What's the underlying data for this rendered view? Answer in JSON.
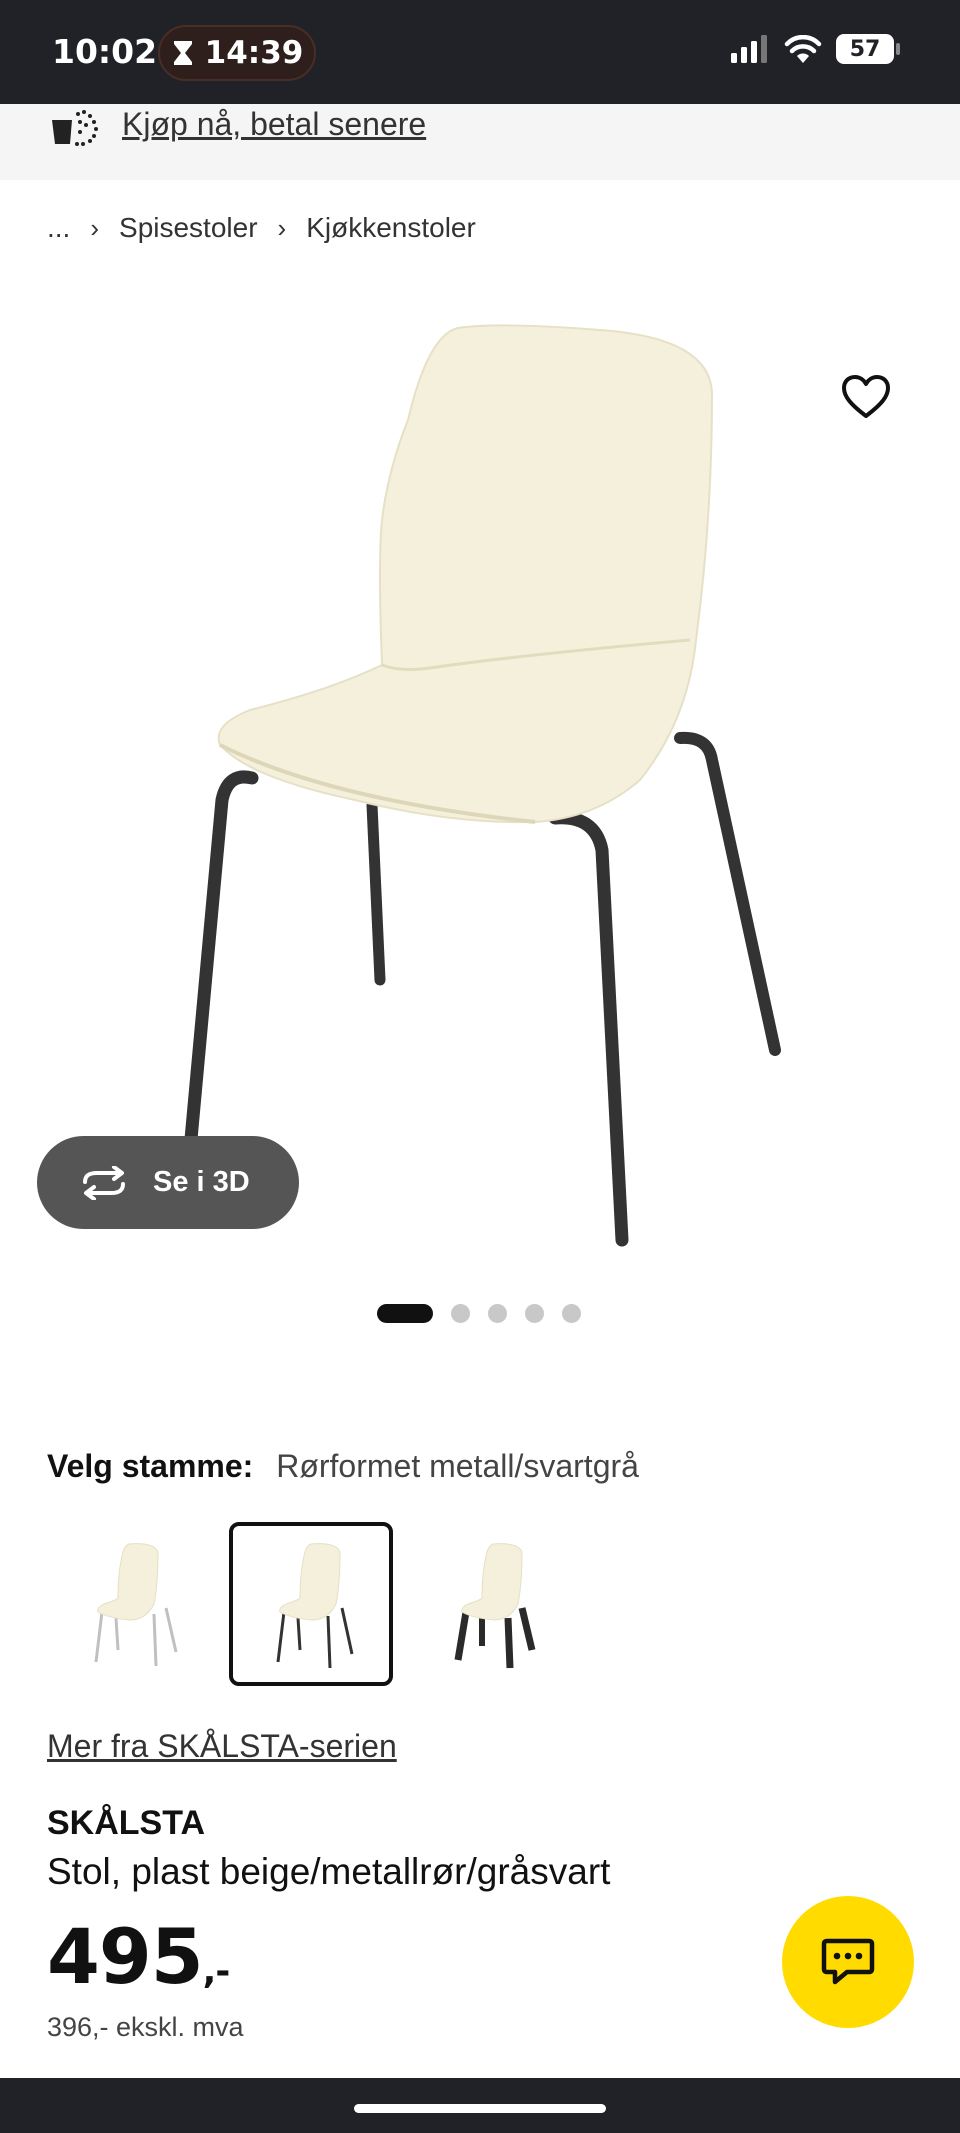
{
  "status_bar": {
    "time": "10:02",
    "timer": "14:39",
    "battery": "57"
  },
  "promo": {
    "link": "Kjøp nå, betal senere"
  },
  "breadcrumb": {
    "items": [
      "...",
      "Spisestoler",
      "Kjøkkenstoler"
    ]
  },
  "gallery": {
    "view_3d_label": "Se i 3D",
    "image_count": 5,
    "active_index": 0
  },
  "variant": {
    "label": "Velg stamme:",
    "value": "Rørformet metall/svartgrå",
    "selected_index": 1
  },
  "series_link": "Mer fra SKÅLSTA-serien",
  "product": {
    "name": "SKÅLSTA",
    "description": "Stol, plast beige/metallrør/gråsvart",
    "price": "495",
    "price_suffix": ",-",
    "price_ex_vat": "396,- ekskl. mva"
  },
  "colors": {
    "status_bar": "#202228",
    "chat_button": "#ffdb00",
    "seat": "#f4f0dc",
    "legs_dark": "#333333",
    "legs_light": "#c8c8c8"
  },
  "icons": {
    "timer": "hourglass-icon",
    "signal": "signal-icon",
    "wifi": "wifi-icon",
    "promo": "bag-icon",
    "favorite": "heart-icon",
    "view_3d": "rotate-icon",
    "chat": "chat-icon"
  }
}
